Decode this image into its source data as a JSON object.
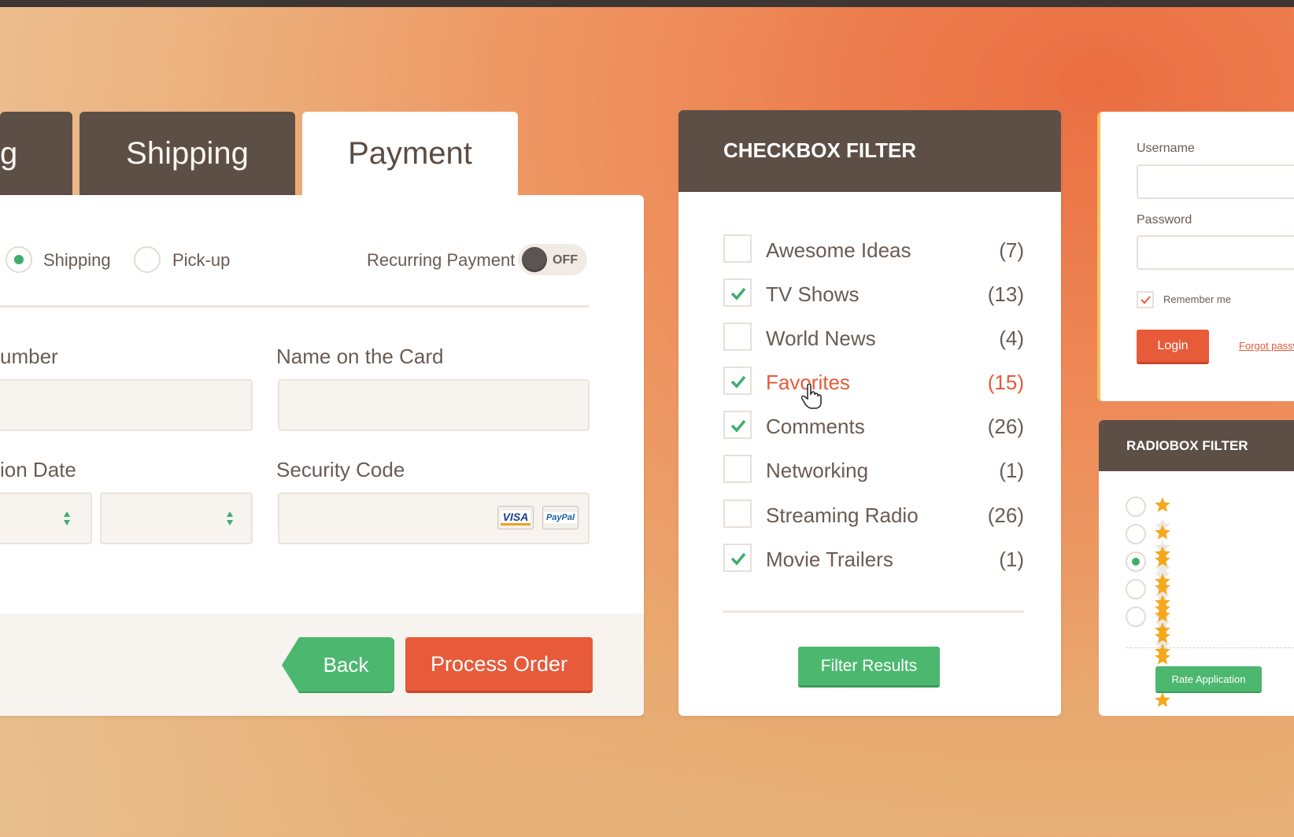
{
  "tabs": [
    {
      "label": "g"
    },
    {
      "label": "Shipping"
    },
    {
      "label": "Payment"
    }
  ],
  "payment": {
    "delivery_options": [
      {
        "label": "Shipping",
        "selected": true
      },
      {
        "label": "Pick-up",
        "selected": false
      }
    ],
    "recurring_label": "Recurring Payment",
    "toggle_state": "OFF",
    "card_number_label": "umber",
    "name_label": "Name on the Card",
    "expiration_label": "ion Date",
    "security_label": "Security Code",
    "card_logos": [
      "VISA",
      "PayPal"
    ],
    "back_label": "Back",
    "process_label": "Process Order"
  },
  "checkbox_filter": {
    "title": "CHECKBOX FILTER",
    "items": [
      {
        "label": "Awesome Ideas",
        "count": "(7)",
        "checked": false
      },
      {
        "label": "TV Shows",
        "count": "(13)",
        "checked": true
      },
      {
        "label": "World News",
        "count": "(4)",
        "checked": false
      },
      {
        "label": "Favorites",
        "count": "(15)",
        "checked": true
      },
      {
        "label": "Comments",
        "count": "(26)",
        "checked": true
      },
      {
        "label": "Networking",
        "count": "(1)",
        "checked": false
      },
      {
        "label": "Streaming Radio",
        "count": "(26)",
        "checked": false
      },
      {
        "label": "Movie Trailers",
        "count": "(1)",
        "checked": true
      }
    ],
    "button_label": "Filter Results"
  },
  "login": {
    "username_label": "Username",
    "password_label": "Password",
    "remember_label": "Remember me",
    "remember_checked": true,
    "login_label": "Login",
    "forgot_label": "Forgot passw"
  },
  "radiobox_filter": {
    "title": "RADIOBOX FILTER",
    "options": [
      {
        "stars": 1,
        "selected": false
      },
      {
        "stars": 2,
        "selected": false
      },
      {
        "stars": 3,
        "selected": true
      },
      {
        "stars": 4,
        "selected": false
      },
      {
        "stars": 5,
        "selected": false
      }
    ],
    "button_label": "Rate Application"
  },
  "colors": {
    "brown": "#5d4f46",
    "green": "#4cb86f",
    "orange_red": "#e75b3a",
    "star": "#f4a81c"
  }
}
